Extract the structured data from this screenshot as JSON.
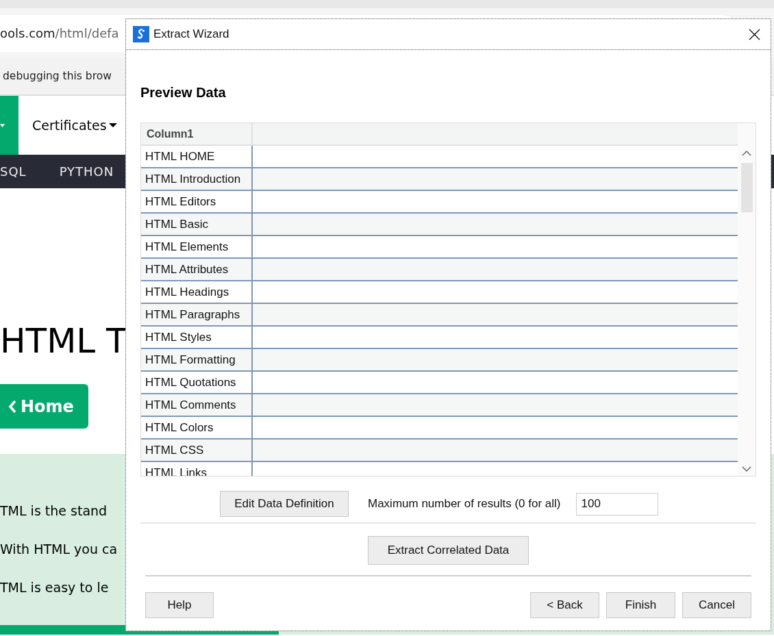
{
  "browser": {
    "url_host": "ools.com",
    "url_path": "/html/defa",
    "info_bar": "debugging this brow"
  },
  "page": {
    "nav_item": "Certificates",
    "menu": [
      "SQL",
      "PYTHON"
    ],
    "heading": "HTML T",
    "home_button": "Home",
    "intro_lines": [
      "TML is the stand",
      "With HTML you ca",
      "TML is easy to le"
    ]
  },
  "dialog": {
    "title": "Extract Wizard",
    "section_title": "Preview Data",
    "table": {
      "columns": [
        "Column1"
      ],
      "rows": [
        [
          "HTML HOME"
        ],
        [
          "HTML Introduction"
        ],
        [
          "HTML Editors"
        ],
        [
          "HTML Basic"
        ],
        [
          "HTML Elements"
        ],
        [
          "HTML Attributes"
        ],
        [
          "HTML Headings"
        ],
        [
          "HTML Paragraphs"
        ],
        [
          "HTML Styles"
        ],
        [
          "HTML Formatting"
        ],
        [
          "HTML Quotations"
        ],
        [
          "HTML Comments"
        ],
        [
          "HTML Colors"
        ],
        [
          "HTML CSS"
        ],
        [
          "HTML Links"
        ]
      ]
    },
    "edit_button": "Edit Data Definition",
    "max_label": "Maximum number of results (0 for all)",
    "max_value": "100",
    "correlated_button": "Extract Correlated Data",
    "help_button": "Help",
    "back_button": "< Back",
    "finish_button": "Finish",
    "cancel_button": "Cancel"
  }
}
